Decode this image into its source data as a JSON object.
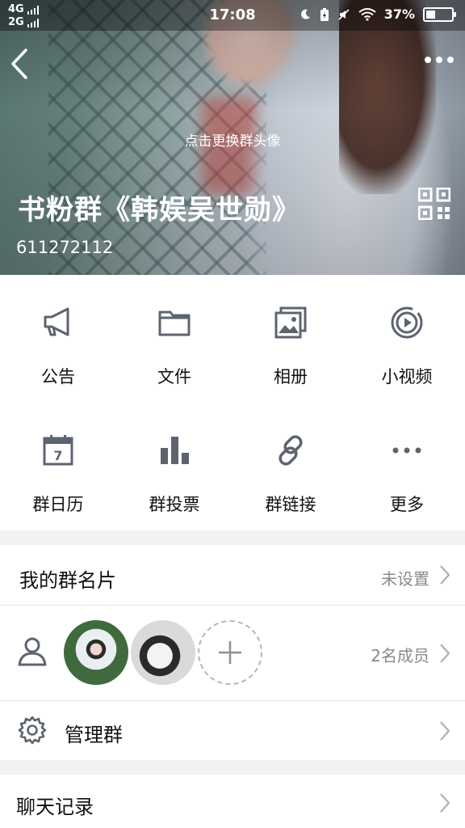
{
  "status_bar": {
    "net_primary": "4G",
    "net_secondary": "2G",
    "time": "17:08",
    "battery_pct": "37%",
    "battery_level": 0.37
  },
  "header": {
    "change_avatar_hint": "点击更换群头像",
    "group_name": "书粉群《韩娱吴世勋》",
    "group_id": "611272112"
  },
  "features": [
    {
      "label": "公告",
      "icon": "megaphone-icon"
    },
    {
      "label": "文件",
      "icon": "folder-icon"
    },
    {
      "label": "相册",
      "icon": "album-icon"
    },
    {
      "label": "小视频",
      "icon": "video-icon"
    },
    {
      "label": "群日历",
      "icon": "calendar-icon",
      "day": "7"
    },
    {
      "label": "群投票",
      "icon": "poll-icon"
    },
    {
      "label": "群链接",
      "icon": "link-icon"
    },
    {
      "label": "更多",
      "icon": "more-icon"
    }
  ],
  "card_row": {
    "title": "我的群名片",
    "value": "未设置"
  },
  "members_row": {
    "value": "2名成员"
  },
  "manage_row": {
    "title": "管理群"
  },
  "chat_row": {
    "title": "聊天记录"
  },
  "colors": {
    "icon_gray": "#5d6470",
    "divider": "#e3e3e6",
    "section_gap": "#f2f2f4"
  }
}
